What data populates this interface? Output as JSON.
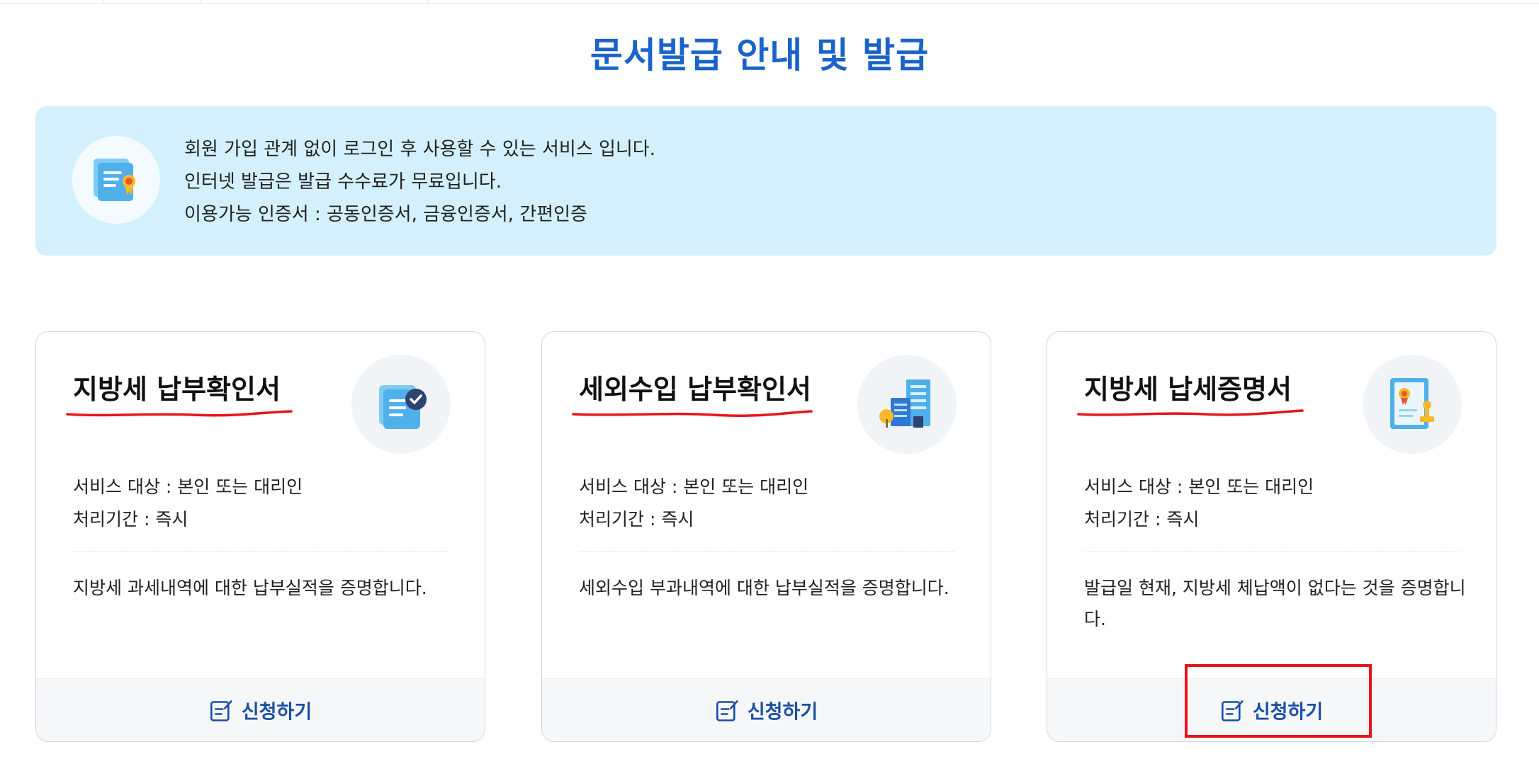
{
  "page": {
    "title": "문서발급 안내 및 발급"
  },
  "notice": {
    "icon": "certificate-scroll-icon",
    "lines": [
      "회원 가입 관계 없이 로그인 후 사용할 수 있는 서비스 입니다.",
      "인터넷 발급은 발급 수수료가 무료입니다.",
      "이용가능 인증서 : 공동인증서, 금융인증서, 간편인증"
    ]
  },
  "cards": [
    {
      "title": "지방세 납부확인서",
      "icon": "document-check-icon",
      "target": "서비스 대상 : 본인 또는 대리인",
      "period": "처리기간 : 즉시",
      "description": "지방세 과세내역에 대한 납부실적을 증명합니다.",
      "apply_label": "신청하기"
    },
    {
      "title": "세외수입 납부확인서",
      "icon": "building-icon",
      "target": "서비스 대상 : 본인 또는 대리인",
      "period": "처리기간 : 즉시",
      "description": "세외수입 부과내역에 대한 납부실적을 증명합니다.",
      "apply_label": "신청하기"
    },
    {
      "title": "지방세 납세증명서",
      "icon": "certificate-stamp-icon",
      "target": "서비스 대상 : 본인 또는 대리인",
      "period": "처리기간 : 즉시",
      "description": "발급일 현재, 지방세 체납액이 없다는 것을 증명합니다.",
      "apply_label": "신청하기"
    }
  ],
  "colors": {
    "title_blue": "#1a63c9",
    "notice_bg": "#d4f0fc",
    "apply_blue": "#1a4fa3",
    "annotation_red": "#e8141b"
  }
}
